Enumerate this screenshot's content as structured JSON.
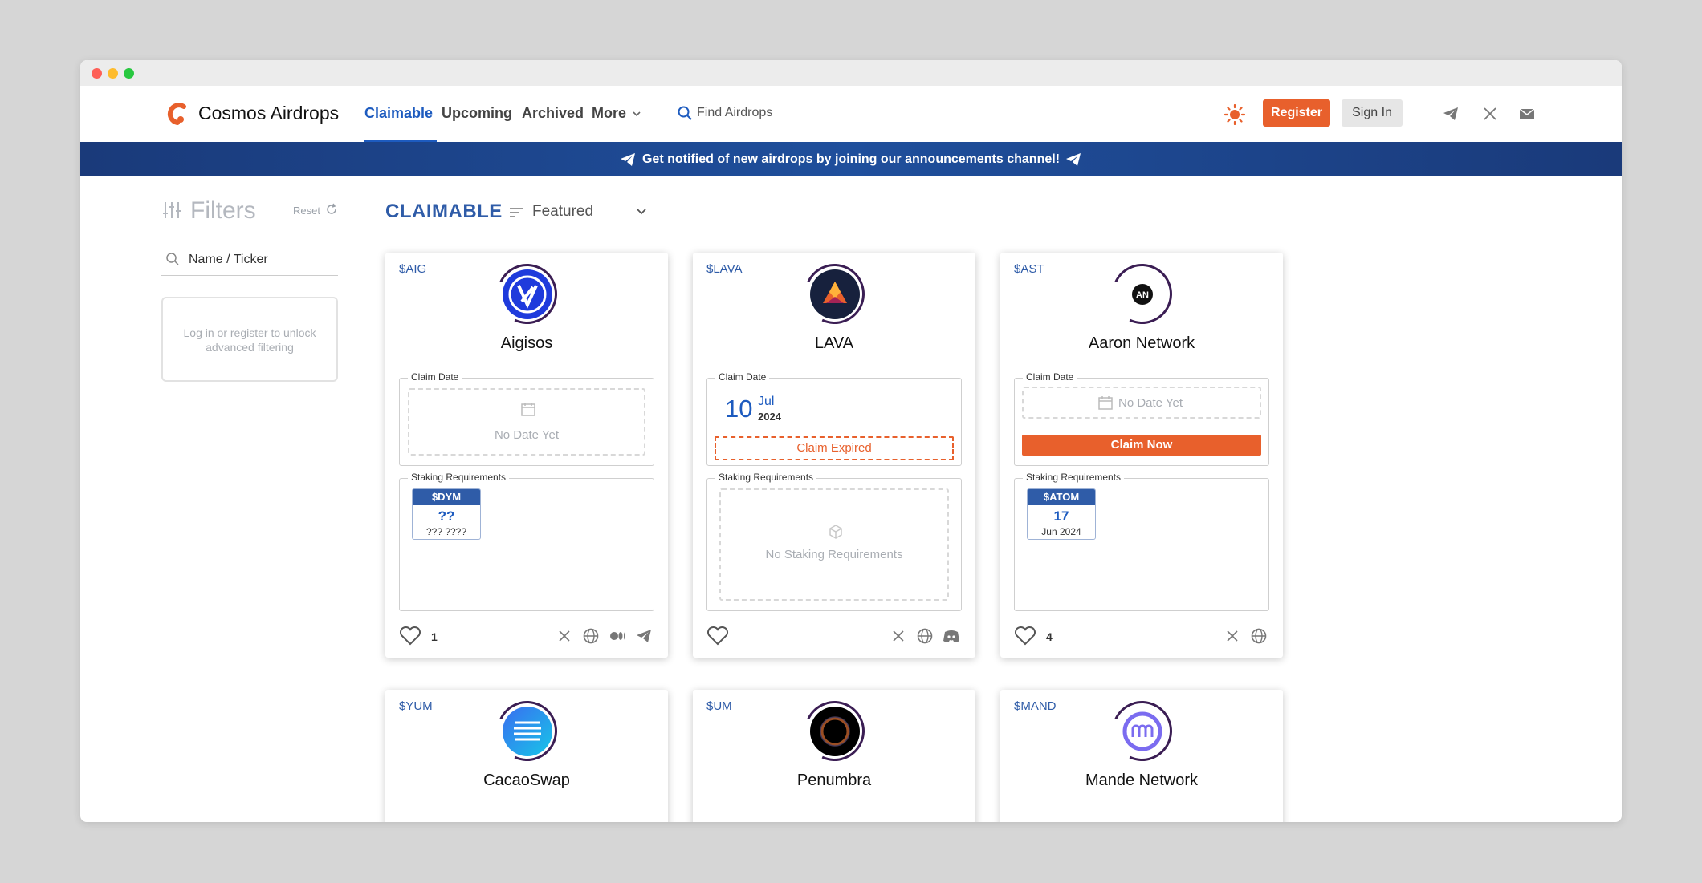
{
  "app": {
    "brand": "Cosmos Airdrops",
    "accent": "#1d5bbf",
    "cta_color": "#e8602c"
  },
  "nav": {
    "items": [
      "Claimable",
      "Upcoming",
      "Archived",
      "More"
    ],
    "active": "Claimable",
    "search_placeholder": "Find Airdrops",
    "register": "Register",
    "signin": "Sign In",
    "icons": [
      "sun-icon",
      "telegram-icon",
      "x-icon",
      "mail-icon"
    ]
  },
  "banner": {
    "text": "Get notified of new airdrops by joining our announcements channel!"
  },
  "filters": {
    "title": "Filters",
    "reset": "Reset",
    "search_placeholder": "Name / Ticker",
    "locked_line1": "Log in or register to unlock",
    "locked_line2": "advanced filtering"
  },
  "main": {
    "section": "CLAIMABLE",
    "sort": "Featured"
  },
  "labels": {
    "claim_date": "Claim Date",
    "staking": "Staking Requirements",
    "no_date": "No Date Yet",
    "claim_expired": "Claim Expired",
    "claim_now": "Claim Now",
    "no_staking": "No Staking Requirements"
  },
  "cards": [
    {
      "ticker": "$AIG",
      "name": "Aigisos",
      "likes": "1",
      "stake": {
        "token": "$DYM",
        "value": "??",
        "date": "??? ????"
      },
      "socials": [
        "x-icon",
        "globe-icon",
        "medium-icon",
        "telegram-icon"
      ]
    },
    {
      "ticker": "$LAVA",
      "name": "LAVA",
      "claim": {
        "day": "10",
        "month": "Jul",
        "year": "2024"
      },
      "socials": [
        "x-icon",
        "globe-icon",
        "discord-icon"
      ]
    },
    {
      "ticker": "$AST",
      "name": "Aaron Network",
      "logo_text": "AN",
      "likes": "4",
      "stake": {
        "token": "$ATOM",
        "value": "17",
        "date": "Jun 2024"
      },
      "socials": [
        "x-icon",
        "globe-icon"
      ]
    },
    {
      "ticker": "$YUM",
      "name": "CacaoSwap"
    },
    {
      "ticker": "$UM",
      "name": "Penumbra"
    },
    {
      "ticker": "$MAND",
      "name": "Mande Network"
    }
  ]
}
